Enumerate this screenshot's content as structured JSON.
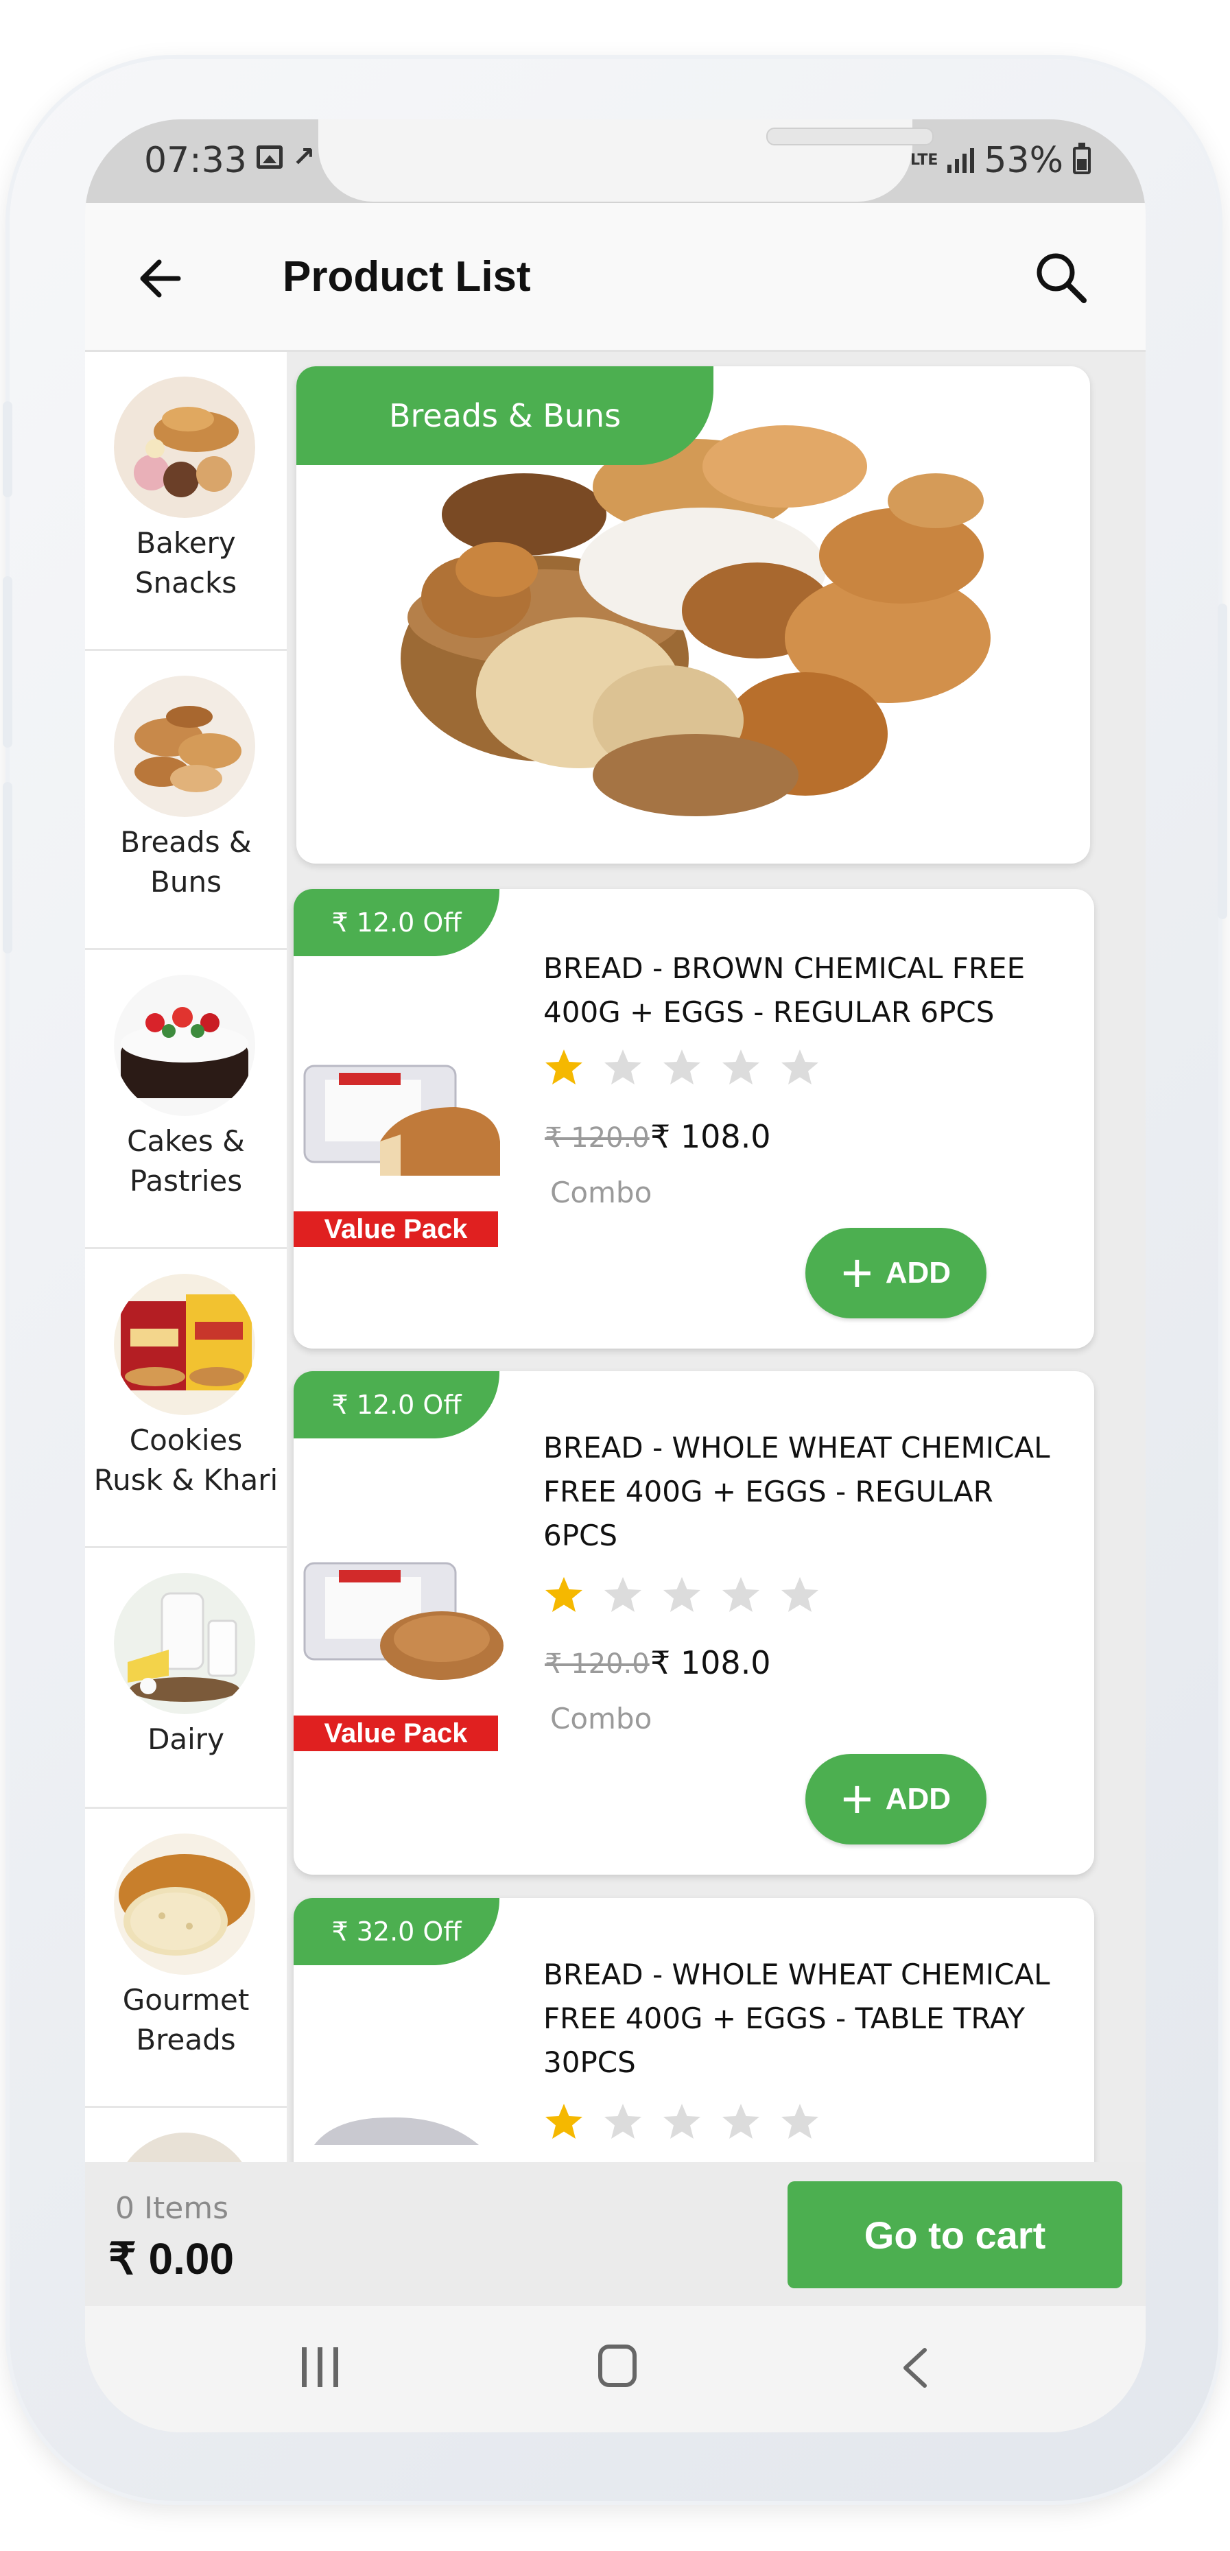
{
  "status_bar": {
    "time": "07:33",
    "network": "LTE",
    "battery": "53%"
  },
  "header": {
    "title": "Product List",
    "back_icon": "arrow-left-icon",
    "search_icon": "search-icon"
  },
  "sidebar": {
    "items": [
      {
        "label": "Bakery\nSnacks"
      },
      {
        "label": "Breads &\nBuns"
      },
      {
        "label": "Cakes &\nPastries"
      },
      {
        "label": "Cookies\nRusk & Khari"
      },
      {
        "label": "Dairy"
      },
      {
        "label": "Gourmet\nBreads"
      }
    ]
  },
  "banner": {
    "title": "Breads & Buns"
  },
  "products": [
    {
      "discount": "₹ 12.0 Off",
      "badge": "Value Pack",
      "name": "BREAD - BROWN  CHEMICAL FREE 400G + EGGS - REGULAR 6PCS",
      "rating": 1,
      "rating_max": 5,
      "mrp": "₹ 120.0",
      "price": "₹ 108.0",
      "type": "Combo",
      "add_label": "ADD"
    },
    {
      "discount": "₹ 12.0 Off",
      "badge": "Value Pack",
      "name": "BREAD - WHOLE WHEAT CHEMICAL FREE 400G + EGGS - REGULAR 6PCS",
      "rating": 1,
      "rating_max": 5,
      "mrp": "₹ 120.0",
      "price": "₹ 108.0",
      "type": "Combo",
      "add_label": "ADD"
    },
    {
      "discount": "₹ 32.0 Off",
      "name": "BREAD - WHOLE WHEAT CHEMICAL FREE 400G + EGGS - TABLE TRAY 30PCS",
      "rating": 1,
      "rating_max": 5
    }
  ],
  "cart": {
    "items": "0 Items",
    "total": "₹ 0.00",
    "button": "Go to cart"
  },
  "colors": {
    "accent": "#4caf50",
    "badge_red": "#e02020",
    "star_filled": "#f5b800",
    "star_empty": "#dcdcdc"
  }
}
